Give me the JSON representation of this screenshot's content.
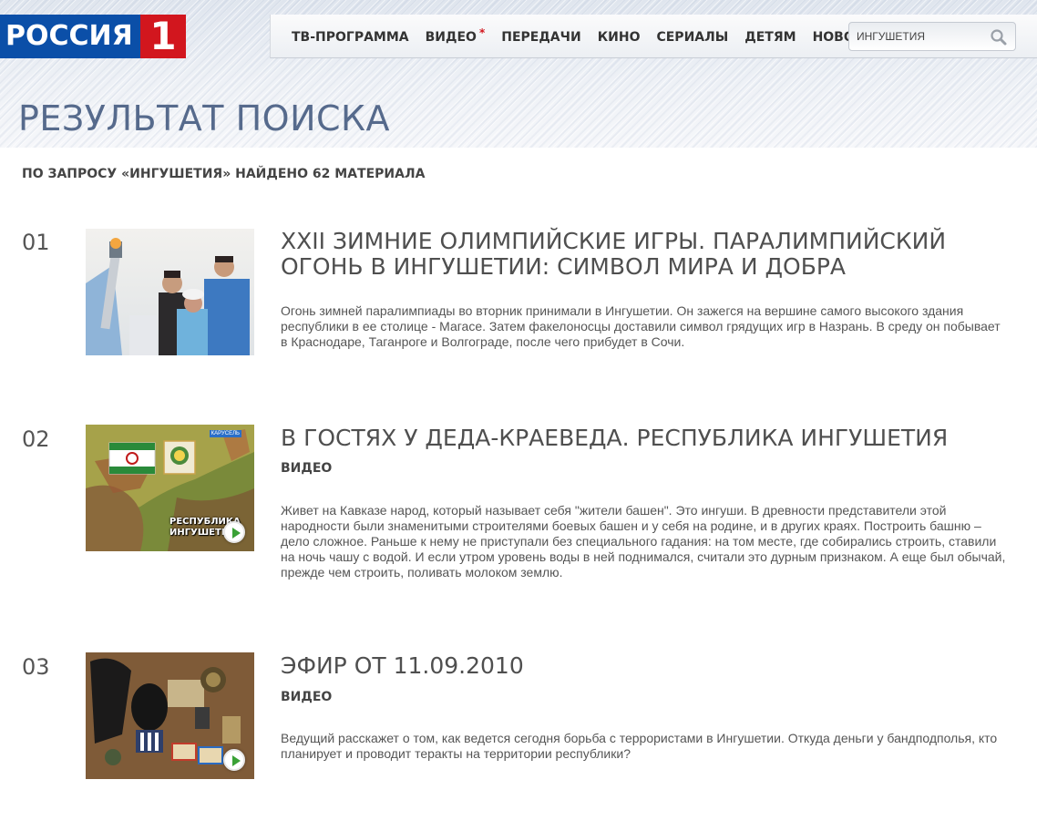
{
  "logo": {
    "word": "РОССИЯ",
    "number": "1"
  },
  "nav": {
    "items": [
      {
        "label": "ТВ-ПРОГРАММА"
      },
      {
        "label": "ВИДЕО",
        "star": "*"
      },
      {
        "label": "ПЕРЕДАЧИ"
      },
      {
        "label": "КИНО"
      },
      {
        "label": "СЕРИАЛЫ"
      },
      {
        "label": "ДЕТЯМ"
      },
      {
        "label": "НОВОСТИ"
      }
    ]
  },
  "search": {
    "value": "ИНГУШЕТИЯ"
  },
  "page": {
    "title": "РЕЗУЛЬТАТ ПОИСКА",
    "count_text": "ПО ЗАПРОСУ «ИНГУШЕТИЯ» НАЙДЕНО 62 МАТЕРИАЛА"
  },
  "results": [
    {
      "num": "01",
      "title": "XXII ЗИМНИЕ ОЛИМПИЙСКИЕ ИГРЫ. ПАРАЛИМПИЙСКИЙ ОГОНЬ В ИНГУШЕТИИ: СИМВОЛ МИРА И ДОБРА",
      "type": "",
      "desc": "Огонь зимней паралимпиады во вторник принимали в Ингушетии. Он зажегся на вершине самого высокого здания республики в ее столице - Магасе. Затем факелоносцы доставили символ грядущих игр в Назрань. В среду он побывает в Краснодаре, Таганроге и Волгограде, после чего прибудет в Сочи."
    },
    {
      "num": "02",
      "title": "В ГОСТЯХ У ДЕДА-КРАЕВЕДА. РЕСПУБЛИКА ИНГУШЕТИЯ",
      "type": "ВИДЕО",
      "desc": "Живет на Кавказе народ, который называет себя \"жители башен\". Это ингуши. В древности представители этой народности были знаменитыми строителями боевых башен и у себя на родине, и в других краях. Построить башню – дело сложное. Раньше к нему не приступали без специального гадания: на том месте, где собирались строить, ставили на ночь чашу с водой. И если утром уровень воды в ней поднимался, считали это дурным признаком. А еще был обычай, прежде чем строить, поливать молоком землю.",
      "thumb_caption": "РЕСПУБЛИКА ИНГУШЕТИЯ",
      "thumb_logo": "КАРУСЕЛЬ"
    },
    {
      "num": "03",
      "title": "ЭФИР ОТ 11.09.2010",
      "type": "ВИДЕО",
      "desc": "Ведущий расскажет о том, как ведется сегодня борьба с террористами в Ингушетии. Откуда деньги у бандподполья, кто планирует и проводит теракты на территории республики?"
    }
  ],
  "colors": {
    "logo_blue": "#0b4fa8",
    "logo_red": "#d2161e",
    "title_blue": "#566a8c",
    "play_green": "#3aa136"
  },
  "icons": {
    "search": "magnifier-icon",
    "play": "play-icon"
  }
}
